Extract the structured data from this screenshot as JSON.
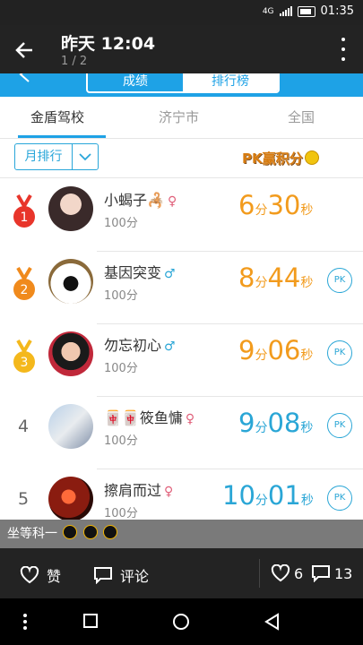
{
  "status_bar": {
    "network": "4G",
    "time": "01:35"
  },
  "viewer": {
    "title": "昨天 12:04",
    "page": "1 / 2"
  },
  "app": {
    "segments": [
      "成绩",
      "排行榜"
    ],
    "tabs": [
      "金盾驾校",
      "济宁市",
      "全国"
    ],
    "filter_label": "月排行",
    "pk_banner": "PK赢积分"
  },
  "leaderboard": [
    {
      "rank": "1",
      "name": "小蝎子🦂",
      "gender": "♀",
      "score": "100分",
      "time_min": "6",
      "min_unit": "分",
      "time_sec": "30",
      "sec_unit": "秒",
      "time_color": "orange",
      "medal": "gold-red",
      "pk": ""
    },
    {
      "rank": "2",
      "name": "基因突变",
      "gender": "♂",
      "score": "100分",
      "time_min": "8",
      "min_unit": "分",
      "time_sec": "44",
      "sec_unit": "秒",
      "time_color": "orange",
      "medal": "orange",
      "pk": "PK"
    },
    {
      "rank": "3",
      "name": "勿忘初心",
      "gender": "♂",
      "score": "100分",
      "time_min": "9",
      "min_unit": "分",
      "time_sec": "06",
      "sec_unit": "秒",
      "time_color": "orange",
      "medal": "yellow",
      "pk": "PK"
    },
    {
      "rank": "4",
      "name": "🀄🀄筱鱼慵",
      "gender": "♀",
      "score": "100分",
      "time_min": "9",
      "min_unit": "分",
      "time_sec": "08",
      "sec_unit": "秒",
      "time_color": "blue",
      "medal": "",
      "pk": "PK"
    },
    {
      "rank": "5",
      "name": "擦肩而过",
      "gender": "♀",
      "score": "100分",
      "time_min": "10",
      "min_unit": "分",
      "time_sec": "01",
      "sec_unit": "秒",
      "time_color": "blue",
      "medal": "",
      "pk": "PK"
    }
  ],
  "caption": {
    "text": "坐等科一"
  },
  "actions": {
    "like": "赞",
    "comment": "评论",
    "like_count": "6",
    "comment_count": "13"
  },
  "colors": {
    "accent": "#1ea2e6",
    "orange_time": "#f29b1d",
    "blue_time": "#2aa6d6"
  }
}
